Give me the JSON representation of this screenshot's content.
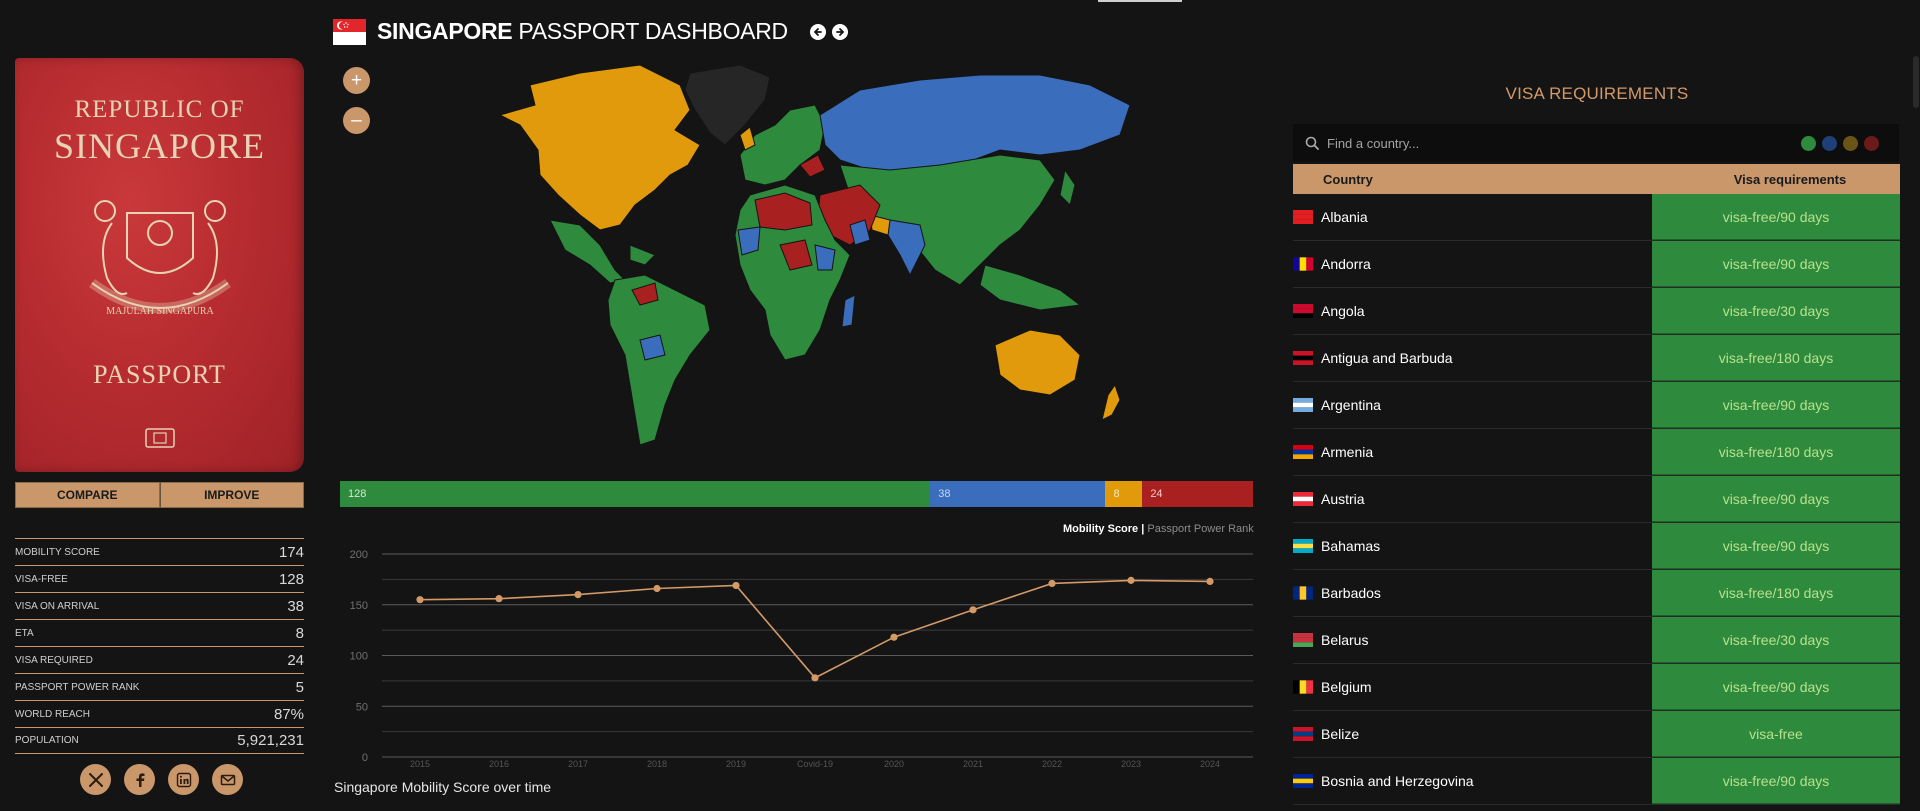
{
  "passport": {
    "cover_line1": "REPUBLIC OF",
    "cover_line2": "SINGAPORE",
    "cover_line3": "PASSPORT",
    "crest_motto": "MAJULAH SINGAPURA"
  },
  "buttons": {
    "compare": "COMPARE",
    "improve": "IMPROVE"
  },
  "stats": [
    {
      "label": "MOBILITY SCORE",
      "value": "174"
    },
    {
      "label": "VISA-FREE",
      "value": "128"
    },
    {
      "label": "VISA ON ARRIVAL",
      "value": "38"
    },
    {
      "label": "ETA",
      "value": "8"
    },
    {
      "label": "VISA REQUIRED",
      "value": "24"
    },
    {
      "label": "PASSPORT POWER RANK",
      "value": "5"
    },
    {
      "label": "WORLD REACH",
      "value": "87%"
    },
    {
      "label": "POPULATION",
      "value": "5,921,231"
    }
  ],
  "social": [
    "x-icon",
    "facebook-icon",
    "linkedin-icon",
    "email-icon"
  ],
  "header": {
    "title_bold": "SINGAPORE",
    "title_rest": " PASSPORT DASHBOARD"
  },
  "map_controls": {
    "zoom_in": "+",
    "zoom_out": "–"
  },
  "summary": [
    {
      "key": "visa_free",
      "value": "128",
      "color": "#2e8b3d"
    },
    {
      "key": "visa_on_arrival",
      "value": "38",
      "color": "#3a6dbb"
    },
    {
      "key": "eta",
      "value": "8",
      "color": "#e19b0a"
    },
    {
      "key": "visa_required",
      "value": "24",
      "color": "#a8201f"
    }
  ],
  "chart_legend": {
    "active": "Mobility Score",
    "separator": " | ",
    "inactive": "Passport Power Rank"
  },
  "chart_data": {
    "type": "line",
    "title": "Singapore Mobility Score over time",
    "categories": [
      "2015",
      "2016",
      "2017",
      "2018",
      "2019",
      "Covid-19",
      "2020",
      "2021",
      "2022",
      "2023",
      "2024"
    ],
    "series": [
      {
        "name": "Mobility Score",
        "values": [
          155,
          156,
          160,
          166,
          169,
          78,
          118,
          145,
          171,
          174,
          173
        ]
      }
    ],
    "ylim": [
      0,
      200
    ],
    "yticks": [
      0,
      50,
      100,
      150,
      200
    ],
    "grid": true,
    "line_color": "#d39a67"
  },
  "visa_panel": {
    "title": "VISA REQUIREMENTS",
    "search_placeholder": "Find a country...",
    "filter_colors": [
      "#2e8b3d",
      "#1f3f77",
      "#6b5418",
      "#6b1b1b"
    ],
    "col_country": "Country",
    "col_visa": "Visa requirements",
    "rows": [
      {
        "country": "Albania",
        "visa": "visa-free/90 days"
      },
      {
        "country": "Andorra",
        "visa": "visa-free/90 days"
      },
      {
        "country": "Angola",
        "visa": "visa-free/30 days"
      },
      {
        "country": "Antigua and Barbuda",
        "visa": "visa-free/180 days"
      },
      {
        "country": "Argentina",
        "visa": "visa-free/90 days"
      },
      {
        "country": "Armenia",
        "visa": "visa-free/180 days"
      },
      {
        "country": "Austria",
        "visa": "visa-free/90 days"
      },
      {
        "country": "Bahamas",
        "visa": "visa-free/90 days"
      },
      {
        "country": "Barbados",
        "visa": "visa-free/180 days"
      },
      {
        "country": "Belarus",
        "visa": "visa-free/30 days"
      },
      {
        "country": "Belgium",
        "visa": "visa-free/90 days"
      },
      {
        "country": "Belize",
        "visa": "visa-free"
      },
      {
        "country": "Bosnia and Herzegovina",
        "visa": "visa-free/90 days"
      }
    ]
  }
}
